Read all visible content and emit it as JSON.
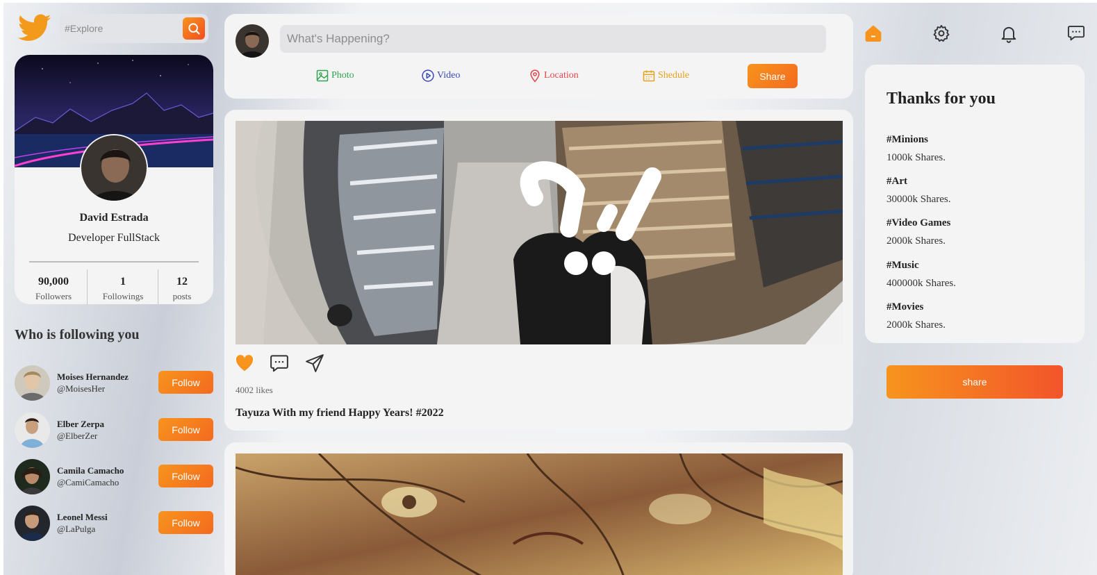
{
  "search": {
    "placeholder": "#Explore"
  },
  "profile": {
    "name": "David Estrada",
    "role": "Developer FullStack",
    "stats": [
      {
        "value": "90,000",
        "label": "Followers"
      },
      {
        "value": "1",
        "label": "Followings"
      },
      {
        "value": "12",
        "label": "posts"
      }
    ]
  },
  "followers": {
    "title": "Who is following you",
    "button_label": "Follow",
    "items": [
      {
        "name": "Moises Hernandez",
        "handle": "@MoisesHer"
      },
      {
        "name": "Elber Zerpa",
        "handle": "@ElberZer"
      },
      {
        "name": "Camila Camacho",
        "handle": "@CamiCamacho"
      },
      {
        "name": "Leonel Messi",
        "handle": "@LaPulga"
      }
    ]
  },
  "compose": {
    "placeholder": "What's Happening?",
    "options": [
      {
        "label": "Photo",
        "color": "#2ea44f"
      },
      {
        "label": "Video",
        "color": "#3a47b5"
      },
      {
        "label": "Location",
        "color": "#e0454a"
      },
      {
        "label": "Shedule",
        "color": "#e3a21e"
      }
    ],
    "share_label": "Share"
  },
  "post": {
    "likes": "4002 likes",
    "caption": "Tayuza With my friend Happy Years! #2022"
  },
  "trends": {
    "title": "Thanks for you",
    "items": [
      {
        "tag": "#Minions",
        "shares": "1000k Shares."
      },
      {
        "tag": "#Art",
        "shares": "30000k Shares."
      },
      {
        "tag": "#Video Games",
        "shares": "2000k Shares."
      },
      {
        "tag": "#Music",
        "shares": "400000k Shares."
      },
      {
        "tag": "#Movies",
        "shares": "2000k Shares."
      }
    ]
  },
  "share_button": {
    "label": "share"
  },
  "colors": {
    "accent": "#f7941d",
    "accent_dark": "#f24d1f",
    "twitter_orange": "#f39a1c"
  },
  "icons": [
    "home-icon",
    "settings-icon",
    "bell-icon",
    "chat-icon"
  ]
}
